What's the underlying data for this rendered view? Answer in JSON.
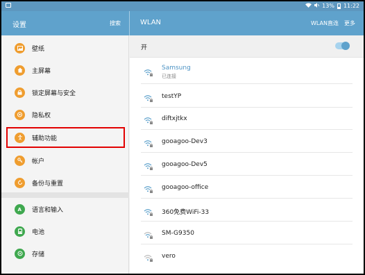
{
  "status_bar": {
    "icons": [
      "image-icon",
      "wifi-icon",
      "mute-icon"
    ],
    "battery": "13%",
    "time": "11:22"
  },
  "settings_header": {
    "title": "设置",
    "search_label": "搜索"
  },
  "wlan_header": {
    "title": "WLAN",
    "direct_label": "WLAN直连",
    "more_label": "更多"
  },
  "sidebar": {
    "items": [
      {
        "label": "壁纸",
        "icon": "wallpaper-icon",
        "color": "#ef9d2f"
      },
      {
        "label": "主屏幕",
        "icon": "home-icon",
        "color": "#ef9d2f"
      },
      {
        "label": "锁定屏幕与安全",
        "icon": "lock-icon",
        "color": "#ef9d2f"
      },
      {
        "label": "隐私权",
        "icon": "privacy-icon",
        "color": "#ef9d2f"
      },
      {
        "label": "辅助功能",
        "icon": "accessibility-icon",
        "color": "#ef9d2f"
      },
      {
        "label": "帐户",
        "icon": "key-icon",
        "color": "#ef9d2f"
      },
      {
        "label": "备份与重置",
        "icon": "backup-icon",
        "color": "#ef9d2f"
      },
      {
        "label": "语言和输入",
        "icon": "language-icon",
        "color": "#3fa84f"
      },
      {
        "label": "电池",
        "icon": "battery-icon",
        "color": "#3fa84f"
      },
      {
        "label": "存储",
        "icon": "storage-icon",
        "color": "#3fa84f"
      }
    ],
    "highlighted": "辅助功能"
  },
  "wlan": {
    "toggle_label": "开",
    "toggle_state": "on",
    "accent_color": "#5fa2cc",
    "networks": [
      {
        "ssid": "Samsung",
        "status": "已连接",
        "connected": true
      },
      {
        "ssid": "testYP",
        "status": ""
      },
      {
        "ssid": "diftxjtkx",
        "status": ""
      },
      {
        "ssid": "gooagoo-Dev3",
        "status": ""
      },
      {
        "ssid": "gooagoo-Dev5",
        "status": ""
      },
      {
        "ssid": "gooagoo-office",
        "status": ""
      },
      {
        "ssid": "360免费WiFi-33",
        "status": ""
      },
      {
        "ssid": "SM-G9350",
        "status": ""
      },
      {
        "ssid": "vero",
        "status": ""
      }
    ]
  }
}
